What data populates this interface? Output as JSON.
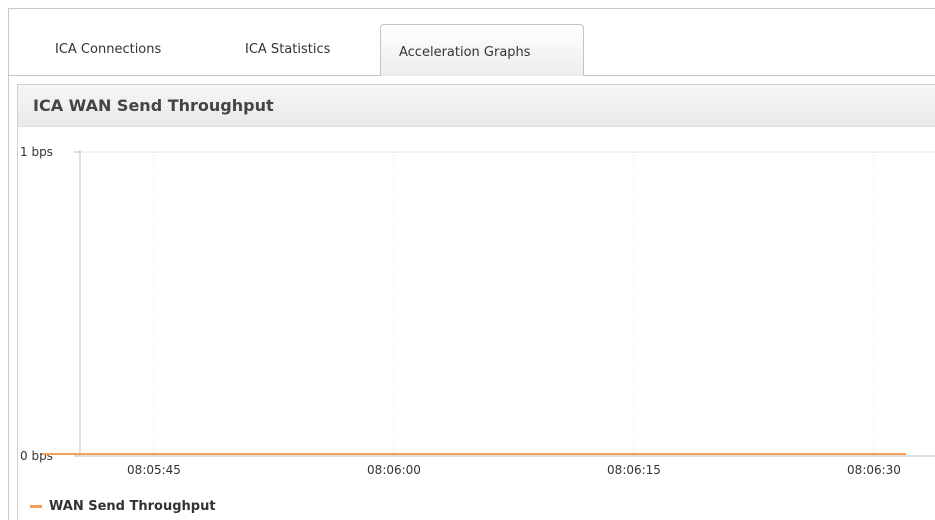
{
  "tabs": [
    {
      "label": "ICA Connections",
      "active": false
    },
    {
      "label": "ICA Statistics",
      "active": false
    },
    {
      "label": "Acceleration Graphs",
      "active": true
    }
  ],
  "panel": {
    "title": "ICA WAN Send Throughput"
  },
  "colors": {
    "series": "#f5a05a",
    "grid": "#e4e4e4",
    "axis": "#bfbfbf"
  },
  "chart_data": {
    "type": "line",
    "title": "ICA WAN Send Throughput",
    "xlabel": "",
    "ylabel": "",
    "x_ticks": [
      "08:05:45",
      "08:06:00",
      "08:06:15",
      "08:06:30"
    ],
    "y_ticks": [
      "1 bps",
      "0 bps"
    ],
    "ylim": [
      0,
      1
    ],
    "series": [
      {
        "name": "WAN Send Throughput",
        "x": [
          "08:05:38",
          "08:05:45",
          "08:06:00",
          "08:06:15",
          "08:06:30",
          "08:06:32"
        ],
        "values": [
          0,
          0,
          0,
          0,
          0,
          0
        ]
      }
    ],
    "grid": true,
    "legend": "bottom-left"
  }
}
